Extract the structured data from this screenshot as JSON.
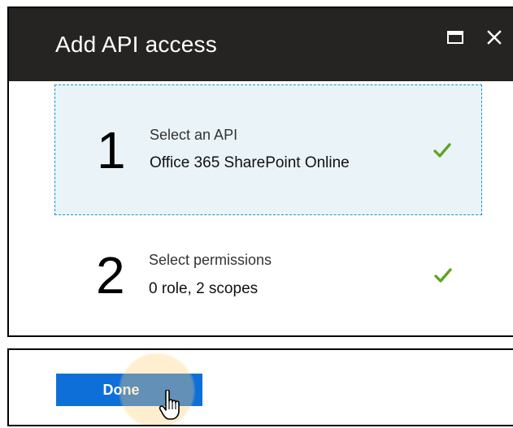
{
  "dialog": {
    "title": "Add API access",
    "maximize_icon": "maximize-icon",
    "close_icon": "close-icon",
    "background_color": "#252423"
  },
  "steps": [
    {
      "number": "1",
      "title": "Select an API",
      "subtitle": "Office 365 SharePoint Online",
      "state": "active",
      "icon": "checkmark-icon",
      "accent_color": "#1594d4"
    },
    {
      "number": "2",
      "title": "Select permissions",
      "subtitle": "0 role, 2 scopes",
      "state": "complete",
      "icon": "checkmark-icon"
    }
  ],
  "footer": {
    "done_label": "Done",
    "button_color": "#0f6fd8",
    "cursor_icon": "pointer-cursor-icon",
    "cursor_highlight_color": "#ffcd78"
  }
}
